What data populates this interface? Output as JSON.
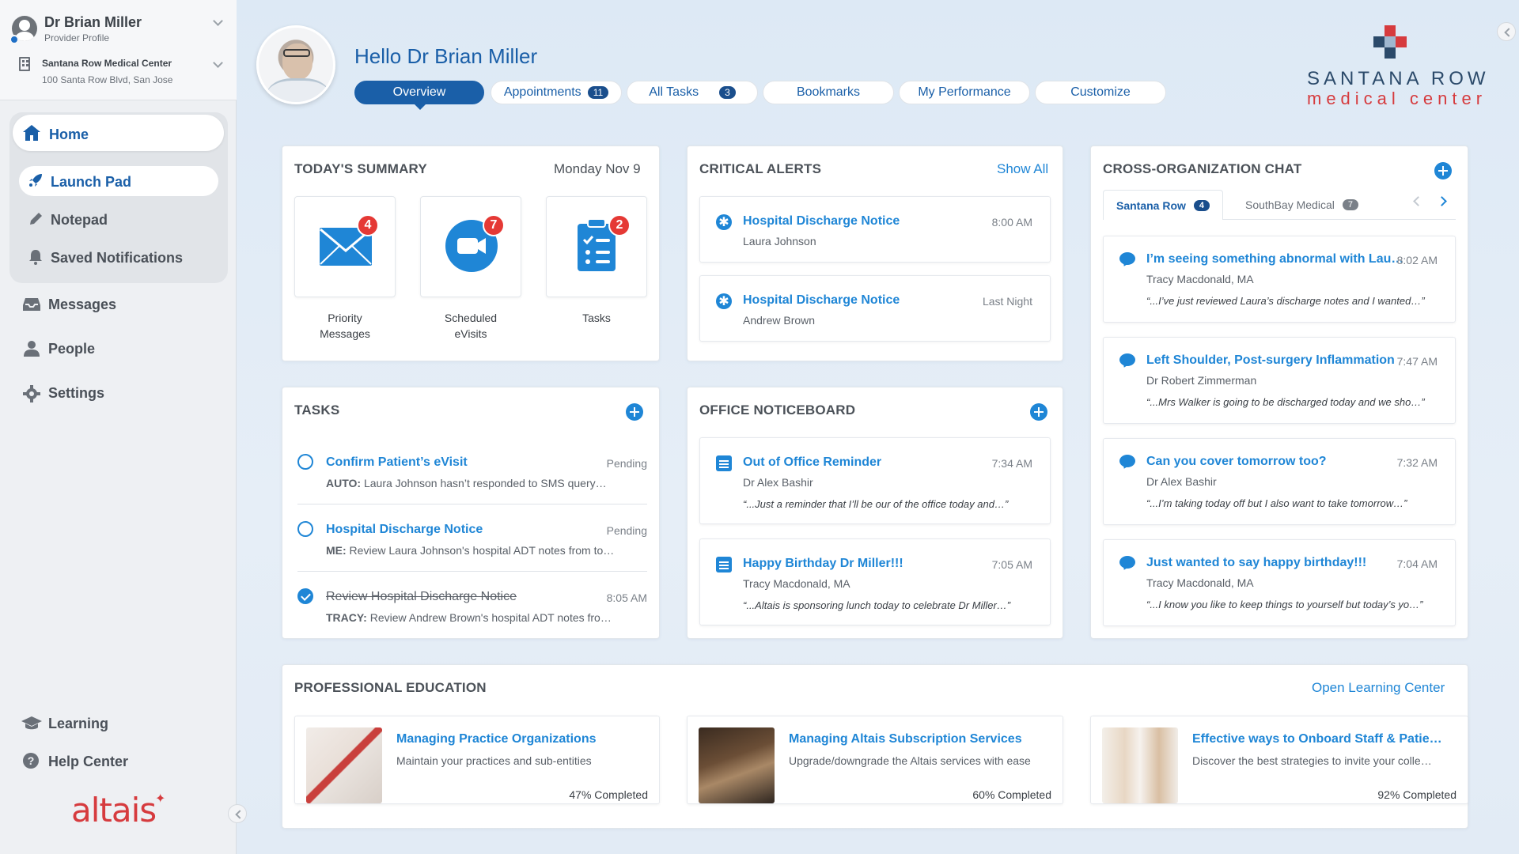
{
  "profile": {
    "name": "Dr Brian Miller",
    "role": "Provider Profile",
    "org_name": "Santana Row Medical Center",
    "org_address": "100 Santa Row Blvd, San Jose"
  },
  "nav": {
    "home": "Home",
    "launch_pad": "Launch Pad",
    "notepad": "Notepad",
    "saved_notifications": "Saved Notifications",
    "messages": "Messages",
    "people": "People",
    "settings": "Settings",
    "learning": "Learning",
    "help_center": "Help Center"
  },
  "brand": {
    "altais": "altais",
    "spark": "✦"
  },
  "header": {
    "greeting": "Hello Dr Brian Miller",
    "tabs": [
      {
        "label": "Overview"
      },
      {
        "label": "Appointments",
        "badge": "11"
      },
      {
        "label": "All Tasks",
        "badge": "3"
      },
      {
        "label": "Bookmarks"
      },
      {
        "label": "My Performance"
      },
      {
        "label": "Customize"
      }
    ],
    "logo_name": "SANTANA ROW",
    "logo_sub": "medical center"
  },
  "summary": {
    "title": "TODAY'S SUMMARY",
    "date": "Monday Nov 9",
    "tiles": [
      {
        "label": "Priority Messages",
        "line1": "Priority",
        "line2": "Messages",
        "count": "4",
        "icon": "envelope-icon"
      },
      {
        "label": "Scheduled eVisits",
        "line1": "Scheduled",
        "line2": "eVisits",
        "count": "7",
        "icon": "video-camera-icon"
      },
      {
        "label": "Tasks",
        "line1": "Tasks",
        "line2": "",
        "count": "2",
        "icon": "clipboard-icon"
      }
    ]
  },
  "alerts": {
    "title": "CRITICAL ALERTS",
    "show_all": "Show All",
    "items": [
      {
        "title": "Hospital Discharge Notice",
        "time": "8:00 AM",
        "person": "Laura Johnson"
      },
      {
        "title": "Hospital Discharge Notice",
        "time": "Last Night",
        "person": "Andrew Brown"
      }
    ]
  },
  "tasks": {
    "title": "TASKS",
    "items": [
      {
        "title": "Confirm Patient’s eVisit",
        "status": "Pending",
        "prefix": "AUTO:",
        "detail": " Laura Johnson hasn’t responded to SMS query…",
        "done": false
      },
      {
        "title": "Hospital Discharge Notice",
        "status": "Pending",
        "prefix": "ME:",
        "detail": " Review Laura Johnson's hospital ADT notes from to…",
        "done": false
      },
      {
        "title": "Review Hospital Discharge Notice",
        "status": "8:05 AM",
        "prefix": "TRACY:",
        "detail": " Review Andrew Brown's hospital ADT notes fro…",
        "done": true
      }
    ]
  },
  "noticeboard": {
    "title": "OFFICE NOTICEBOARD",
    "items": [
      {
        "title": "Out of Office Reminder",
        "time": "7:34 AM",
        "author": "Dr Alex Bashir",
        "quote": "“...Just a reminder that I’ll be our of the office today and…”"
      },
      {
        "title": "Happy Birthday Dr Miller!!!",
        "time": "7:05 AM",
        "author": "Tracy Macdonald, MA",
        "quote": "“...Altais is sponsoring lunch today to celebrate Dr Miller…”"
      }
    ]
  },
  "chat": {
    "title": "CROSS-ORGANIZATION CHAT",
    "tabs": [
      {
        "label": "Santana Row",
        "badge": "4"
      },
      {
        "label": "SouthBay Medical",
        "badge": "7"
      }
    ],
    "items": [
      {
        "title": "I’m seeing something abnormal with Lau…",
        "time": "8:02 AM",
        "author": "Tracy Macdonald, MA",
        "quote": "“...I’ve just reviewed Laura’s discharge notes and I wanted…”"
      },
      {
        "title": "Left Shoulder, Post-surgery Inflammation",
        "time": "7:47 AM",
        "author": "Dr Robert Zimmerman",
        "quote": "“...Mrs Walker is going to be discharged today and we sho…”"
      },
      {
        "title": "Can you cover tomorrow too?",
        "time": "7:32 AM",
        "author": "Dr Alex Bashir",
        "quote": "“...I’m taking today off but I also want to take tomorrow…”"
      },
      {
        "title": "Just wanted to say happy birthday!!!",
        "time": "7:04 AM",
        "author": "Tracy Macdonald, MA",
        "quote": "“...I know you like to keep things to yourself but today’s yo…”"
      }
    ]
  },
  "education": {
    "title": "PROFESSIONAL EDUCATION",
    "open_link": "Open Learning Center",
    "items": [
      {
        "title": "Managing Practice Organizations",
        "desc": "Maintain your practices and sub-entities",
        "pct": "47% Completed"
      },
      {
        "title": "Managing Altais Subscription Services",
        "desc": "Upgrade/downgrade the Altais services with ease",
        "pct": "60% Completed"
      },
      {
        "title": "Effective ways to Onboard Staff & Patie…",
        "desc": "Discover the best strategies to invite your colle…",
        "pct": "92% Completed"
      }
    ]
  },
  "colors": {
    "accent": "#1f86d6",
    "primary": "#1a5fa8",
    "alert": "#e53935",
    "brand_red": "#d63b3e"
  }
}
